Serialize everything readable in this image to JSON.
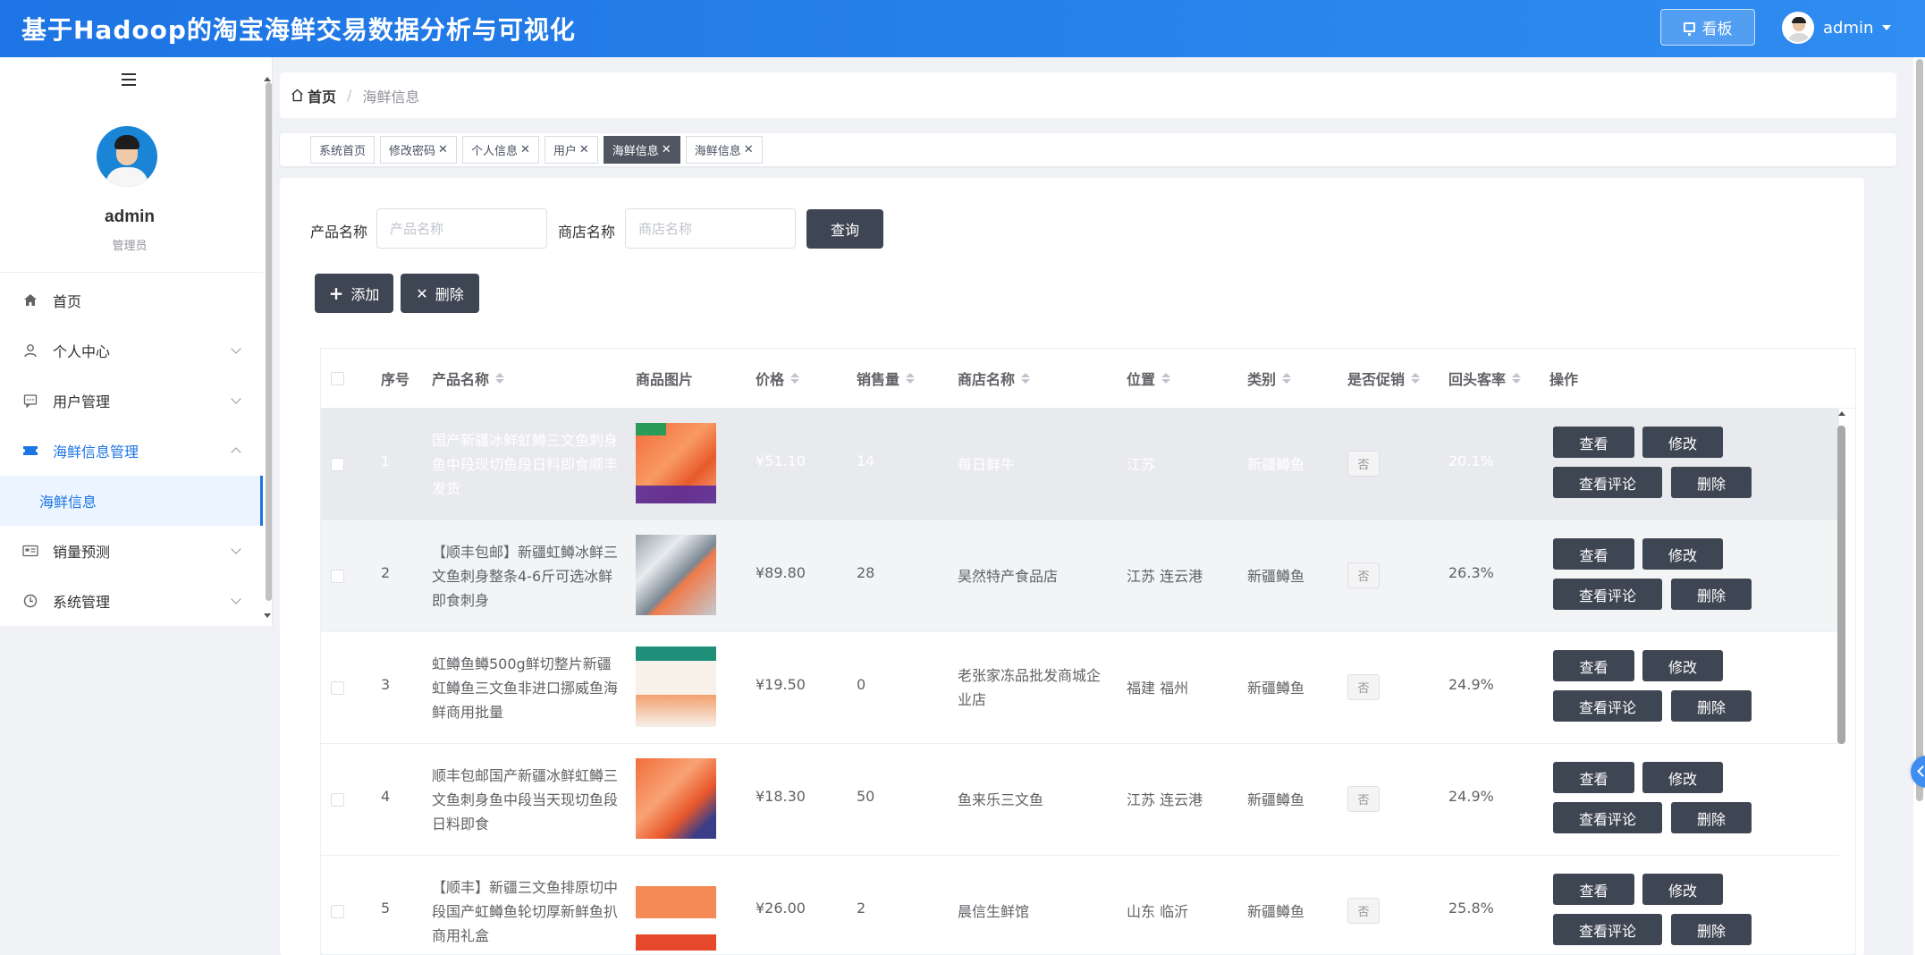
{
  "header": {
    "title": "基于Hadoop的淘宝海鲜交易数据分析与可视化",
    "kanban_label": "看板",
    "user_name": "admin"
  },
  "sidebar": {
    "profile_name": "admin",
    "profile_role": "管理员",
    "items": [
      {
        "label": "首页",
        "icon": "home-icon"
      },
      {
        "label": "个人中心",
        "icon": "user-icon"
      },
      {
        "label": "用户管理",
        "icon": "chat-icon"
      },
      {
        "label": "海鲜信息管理",
        "icon": "ticket-icon"
      },
      {
        "label": "销量预测",
        "icon": "card-icon"
      },
      {
        "label": "系统管理",
        "icon": "clock-icon"
      }
    ],
    "subitem": "海鲜信息"
  },
  "breadcrumb": {
    "home": "首页",
    "current": "海鲜信息"
  },
  "tags": [
    {
      "label": "系统首页",
      "closable": false
    },
    {
      "label": "修改密码",
      "closable": true
    },
    {
      "label": "个人信息",
      "closable": true
    },
    {
      "label": "用户",
      "closable": true
    },
    {
      "label": "海鲜信息",
      "closable": true
    },
    {
      "label": "海鲜信息",
      "closable": true
    }
  ],
  "search": {
    "product_label": "产品名称",
    "product_placeholder": "产品名称",
    "shop_label": "商店名称",
    "shop_placeholder": "商店名称",
    "query_label": "查询"
  },
  "actions": {
    "add_label": "添加",
    "delete_label": "删除"
  },
  "table": {
    "headers": {
      "index": "序号",
      "name": "产品名称",
      "image": "商品图片",
      "price": "价格",
      "sales": "销售量",
      "shop": "商店名称",
      "location": "位置",
      "category": "类别",
      "promo": "是否促销",
      "repeat": "回头客率",
      "ops": "操作"
    },
    "op_labels": {
      "view": "查看",
      "edit": "修改",
      "comments": "查看评论",
      "delete": "删除"
    },
    "rows": [
      {
        "index": "1",
        "name": "国产新疆冰鲜虹鳟三文鱼刺身鱼中段现切鱼段日料即食顺丰发货",
        "price": "¥51.10",
        "sales": "14",
        "shop": "每日鲜牛",
        "location": "江苏",
        "category": "新疆鳟鱼",
        "promo": "否",
        "repeat": "20.1%"
      },
      {
        "index": "2",
        "name": "【顺丰包邮】新疆虹鳟冰鲜三文鱼刺身整条4-6斤可选冰鲜即食刺身",
        "price": "¥89.80",
        "sales": "28",
        "shop": "昊然特产食品店",
        "location": "江苏 连云港",
        "category": "新疆鳟鱼",
        "promo": "否",
        "repeat": "26.3%"
      },
      {
        "index": "3",
        "name": "虹鳟鱼鳟500g鲜切整片新疆虹鳟鱼三文鱼非进口挪威鱼海鲜商用批量",
        "price": "¥19.50",
        "sales": "0",
        "shop": "老张家冻品批发商城企业店",
        "location": "福建 福州",
        "category": "新疆鳟鱼",
        "promo": "否",
        "repeat": "24.9%"
      },
      {
        "index": "4",
        "name": "顺丰包邮国产新疆冰鲜虹鳟三文鱼刺身鱼中段当天现切鱼段日料即食",
        "price": "¥18.30",
        "sales": "50",
        "shop": "鱼来乐三文鱼",
        "location": "江苏 连云港",
        "category": "新疆鳟鱼",
        "promo": "否",
        "repeat": "24.9%"
      },
      {
        "index": "5",
        "name": "【顺丰】新疆三文鱼排原切中段国产虹鳟鱼轮切厚新鲜鱼扒商用礼盒",
        "price": "¥26.00",
        "sales": "2",
        "shop": "晨信生鲜馆",
        "location": "山东 临沂",
        "category": "新疆鳟鱼",
        "promo": "否",
        "repeat": "25.8%"
      }
    ]
  },
  "colors": {
    "header_blue": "#1d74e4",
    "dark_button": "#3f4653",
    "active_blue": "#1d74e4"
  }
}
